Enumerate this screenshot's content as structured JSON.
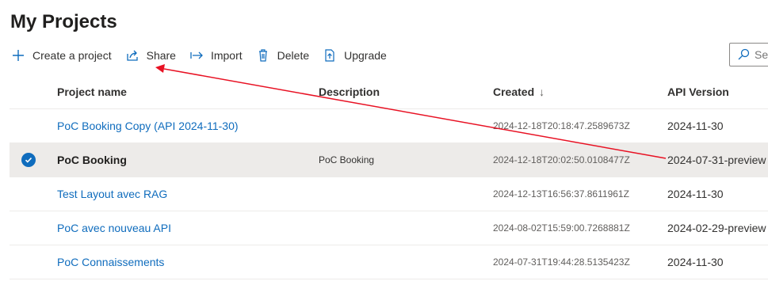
{
  "page": {
    "title": "My Projects"
  },
  "toolbar": {
    "create": "Create a project",
    "share": "Share",
    "import": "Import",
    "delete": "Delete",
    "upgrade": "Upgrade"
  },
  "search": {
    "placeholder": "Se"
  },
  "table": {
    "headers": {
      "name": "Project name",
      "description": "Description",
      "created": "Created",
      "created_sort": "↓",
      "api": "API Version"
    },
    "rows": [
      {
        "name": "PoC Booking Copy (API 2024-11-30)",
        "description": "",
        "created": "2024-12-18T20:18:47.2589673Z",
        "api": "2024-11-30",
        "selected": false
      },
      {
        "name": "PoC Booking",
        "description": "PoC Booking",
        "created": "2024-12-18T20:02:50.0108477Z",
        "api": "2024-07-31-preview",
        "selected": true
      },
      {
        "name": "Test Layout avec RAG",
        "description": "",
        "created": "2024-12-13T16:56:37.8611961Z",
        "api": "2024-11-30",
        "selected": false
      },
      {
        "name": "PoC avec nouveau API",
        "description": "",
        "created": "2024-08-02T15:59:00.7268881Z",
        "api": "2024-02-29-preview",
        "selected": false
      },
      {
        "name": "PoC Connaissements",
        "description": "",
        "created": "2024-07-31T19:44:28.5135423Z",
        "api": "2024-11-30",
        "selected": false
      }
    ]
  },
  "colors": {
    "accent": "#0f6cbd",
    "annotation": "#e81123",
    "selected_row": "#edebe9"
  }
}
